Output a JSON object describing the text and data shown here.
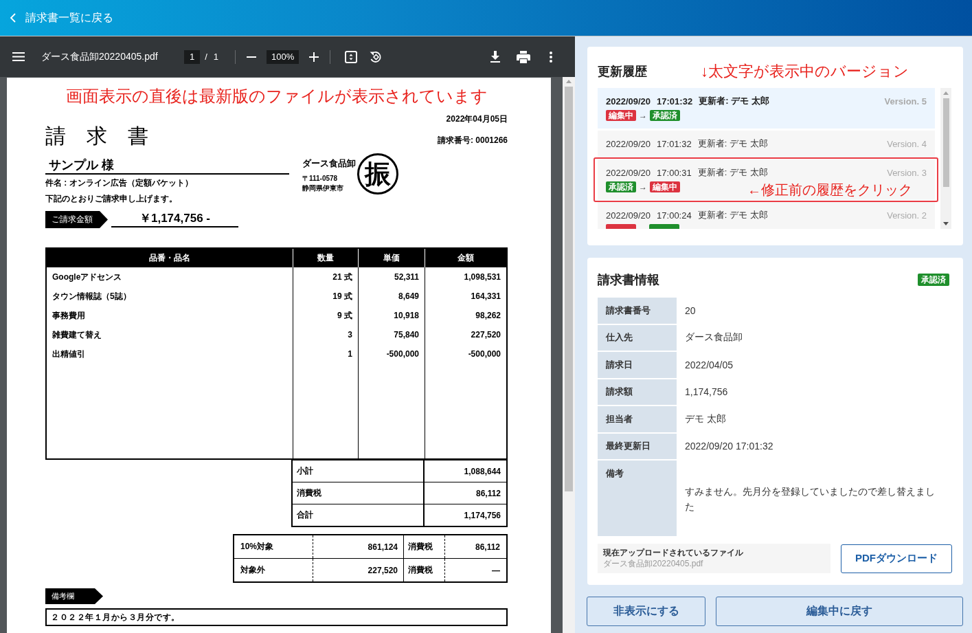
{
  "header": {
    "back_link": "請求書一覧に戻る"
  },
  "pdf_viewer": {
    "toolbar": {
      "file_name": "ダース食品卸20220405.pdf",
      "page": "1",
      "page_separator": "/",
      "page_count": "1",
      "zoom": "100%"
    },
    "document": {
      "annotation": "画面表示の直後は最新版のファイルが表示されています",
      "date": "2022年04月05日",
      "title": "請　求　書",
      "invoice_number": "請求番号: 0001266",
      "recipient": "サンプル 様",
      "subject": "件名 : オンライン広告（定額バケット）",
      "greeting": "下記のとおりご請求申し上げます。",
      "amount_label": "ご請求金額",
      "amount": "￥1,174,756 -",
      "issuer": {
        "name": "ダース食品卸",
        "postal_code": "〒111-0578",
        "address": "静岡県伊東市"
      },
      "stamp": "振",
      "items_table": {
        "columns": [
          "品番・品名",
          "数量",
          "単価",
          "金額"
        ],
        "rows": [
          [
            "Googleアドセンス",
            "21 式",
            "52,311",
            "1,098,531"
          ],
          [
            "タウン情報誌（5誌）",
            "19 式",
            "8,649",
            "164,331"
          ],
          [
            "事務費用",
            "9 式",
            "10,918",
            "98,262"
          ],
          [
            "雑費建て替え",
            "3",
            "75,840",
            "227,520"
          ],
          [
            "出精値引",
            "1",
            "-500,000",
            "-500,000"
          ]
        ]
      },
      "totals": [
        {
          "label": "小計",
          "value": "1,088,644"
        },
        {
          "label": "消費税",
          "value": "86,112"
        },
        {
          "label": "合計",
          "value": "1,174,756"
        }
      ],
      "tax_table": {
        "rows": [
          [
            "10%対象",
            "861,124",
            "消費税",
            "86,112"
          ],
          [
            "対象外",
            "227,520",
            "消費税",
            "—"
          ]
        ]
      },
      "remarks_label": "備考欄",
      "remarks": "２０２２年１月から３月分です。"
    }
  },
  "history": {
    "title": "更新履歴",
    "annotation": "↓太文字が表示中のバージョン",
    "items": [
      {
        "date": "2022/09/20",
        "time": "17:01:32",
        "editor": "更新者: デモ 太郎",
        "version": "Version. 5",
        "selected": true,
        "highlighted": false,
        "changes": [
          {
            "kind": "editing",
            "label": "編集中"
          },
          {
            "kind": "approved",
            "label": "承認済"
          }
        ],
        "arrow": "→"
      },
      {
        "date": "2022/09/20",
        "time": "17:01:32",
        "editor": "更新者: デモ 太郎",
        "version": "Version. 4",
        "selected": false,
        "highlighted": false
      },
      {
        "date": "2022/09/20",
        "time": "17:00:31",
        "editor": "更新者: デモ 太郎",
        "version": "Version. 3",
        "selected": false,
        "highlighted": true,
        "annotation": "←修正前の履歴をクリック",
        "changes": [
          {
            "kind": "approved",
            "label": "承認済"
          },
          {
            "kind": "editing",
            "label": "編集中"
          }
        ],
        "arrow": "→"
      },
      {
        "date": "2022/09/20",
        "time": "17:00:24",
        "editor": "更新者: デモ 太郎",
        "version": "Version. 2",
        "selected": false,
        "highlighted": false,
        "changes": [
          {
            "kind": "editing"
          },
          {
            "kind": "approved"
          }
        ]
      }
    ]
  },
  "invoice_info": {
    "title": "請求書情報",
    "status": {
      "kind": "approved",
      "label": "承認済"
    },
    "fields": [
      {
        "kind": "text",
        "label": "請求書番号",
        "value": "20"
      },
      {
        "kind": "text",
        "label": "仕入先",
        "value": "ダース食品卸"
      },
      {
        "kind": "text",
        "label": "請求日",
        "value": "2022/04/05"
      },
      {
        "kind": "text",
        "label": "請求額",
        "value": "1,174,756"
      },
      {
        "kind": "text",
        "label": "担当者",
        "value": "デモ 太郎"
      },
      {
        "kind": "text",
        "label": "最終更新日",
        "value": "2022/09/20 17:01:32"
      },
      {
        "kind": "note",
        "label": "備考",
        "value": "すみません。先月分を登録していましたので差し替えました"
      }
    ],
    "current_file": {
      "label": "現在アップロードされているファイル",
      "name": "ダース食品卸20220405.pdf"
    },
    "download_button": "PDFダウンロード"
  },
  "actions": [
    {
      "label": "非表示にする"
    },
    {
      "label": "編集中に戻す"
    }
  ]
}
